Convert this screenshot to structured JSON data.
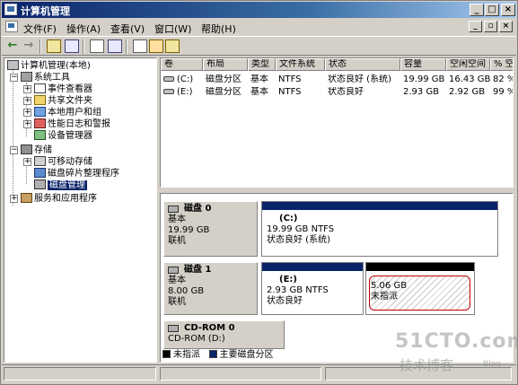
{
  "window": {
    "title": "计算机管理"
  },
  "menu": {
    "items": [
      "文件(F)",
      "操作(A)",
      "查看(V)",
      "窗口(W)",
      "帮助(H)"
    ]
  },
  "tree": {
    "root": "计算机管理(本地)",
    "system_tools": "系统工具",
    "event_viewer": "事件查看器",
    "shared_folders": "共享文件夹",
    "local_users": "本地用户和组",
    "perf_logs": "性能日志和警报",
    "device_manager": "设备管理器",
    "storage": "存储",
    "removable": "可移动存储",
    "defrag": "磁盘碎片整理程序",
    "disk_mgmt": "磁盘管理",
    "services": "服务和应用程序"
  },
  "volume_list": {
    "columns": [
      "卷",
      "布局",
      "类型",
      "文件系统",
      "状态",
      "容量",
      "空闲空间",
      "% 空"
    ],
    "rows": [
      [
        "(C:)",
        "磁盘分区",
        "基本",
        "NTFS",
        "状态良好 (系统)",
        "19.99 GB",
        "16.43 GB",
        "82 %"
      ],
      [
        "(E:)",
        "磁盘分区",
        "基本",
        "NTFS",
        "状态良好",
        "2.93 GB",
        "2.92 GB",
        "99 %"
      ]
    ]
  },
  "disks": [
    {
      "name": "磁盘 0",
      "type": "基本",
      "size": "19.99 GB",
      "status": "联机",
      "partitions": [
        {
          "name": "(C:)",
          "line1": "19.99 GB NTFS",
          "line2": "状态良好 (系统)"
        }
      ]
    },
    {
      "name": "磁盘 1",
      "type": "基本",
      "size": "8.00 GB",
      "status": "联机",
      "partitions": [
        {
          "name": "(E:)",
          "line1": "2.93 GB NTFS",
          "line2": "状态良好"
        },
        {
          "name": "",
          "line1": "5.06 GB",
          "line2": "未指派"
        }
      ]
    },
    {
      "name": "CD-ROM 0",
      "type": "CD-ROM (D:)",
      "size": "",
      "status": "",
      "partitions": []
    }
  ],
  "legend": {
    "unallocated": "未指派",
    "primary": "主要磁盘分区"
  },
  "colors": {
    "title_start": "#0a246a",
    "primary_partition": "#0a246a",
    "unallocated": "#000000",
    "selected": "#0a246a"
  },
  "watermark": {
    "line1": "51CTO.com",
    "line2": "技术博客",
    "line3": "Blog"
  }
}
